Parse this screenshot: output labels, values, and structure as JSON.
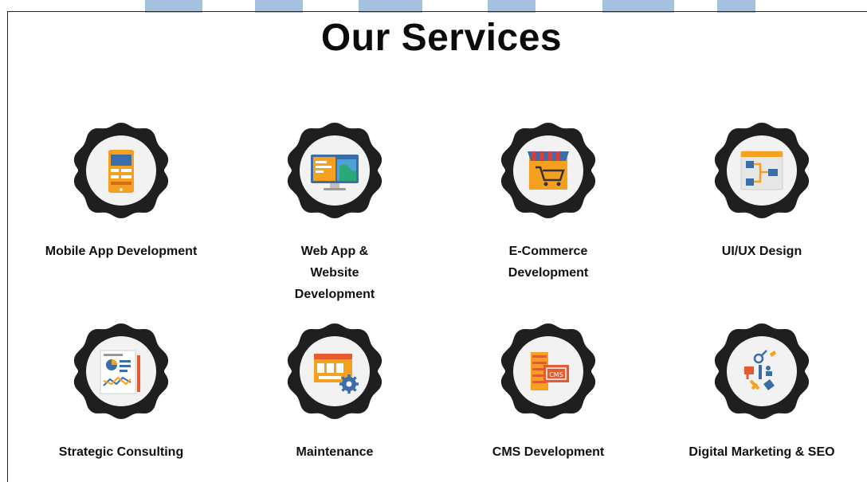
{
  "page": {
    "title": "Our Services"
  },
  "services": [
    {
      "label": "Mobile App Development",
      "icon": "mobile-app-icon"
    },
    {
      "label": "Web App & Website Development",
      "icon": "web-app-icon"
    },
    {
      "label": "E-Commerce Development",
      "icon": "ecommerce-cart-icon"
    },
    {
      "label": "UI/UX Design",
      "icon": "ux-flowchart-icon"
    },
    {
      "label": "Strategic Consulting",
      "icon": "consulting-chart-icon"
    },
    {
      "label": "Maintenance",
      "icon": "maintenance-gear-icon"
    },
    {
      "label": "CMS Development",
      "icon": "cms-server-icon"
    },
    {
      "label": "Digital Marketing & SEO",
      "icon": "digital-marketing-icon"
    }
  ],
  "colors": {
    "badge": "#1f1f1f",
    "circle": "#f2f2f2",
    "orange": "#f5a01e",
    "blue": "#3b6ea8",
    "accent_bg": "#5a8fc7"
  }
}
